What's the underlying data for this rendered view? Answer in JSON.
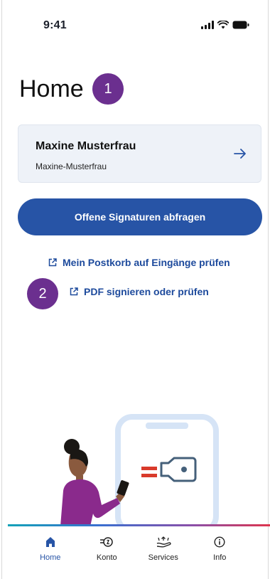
{
  "status_bar": {
    "time": "9:41"
  },
  "page": {
    "title": "Home"
  },
  "badges": {
    "first": "1",
    "second": "2"
  },
  "profile": {
    "name": "Maxine Musterfrau",
    "username": "Maxine-Musterfrau"
  },
  "actions": {
    "primary_button": "Offene Signaturen abfragen",
    "link_postkorb": "Mein Postkorb auf Eingänge prüfen",
    "link_pdf": "PDF signieren oder prüfen"
  },
  "tabs": [
    {
      "label": "Home",
      "icon": "home-icon",
      "active": true
    },
    {
      "label": "Konto",
      "icon": "account-icon",
      "active": false
    },
    {
      "label": "Services",
      "icon": "services-icon",
      "active": false
    },
    {
      "label": "Info",
      "icon": "info-icon",
      "active": false
    }
  ],
  "colors": {
    "primary": "#2754a6",
    "badge": "#6b2f8f",
    "card_bg": "#eef2f8",
    "link": "#1d4a9c"
  }
}
